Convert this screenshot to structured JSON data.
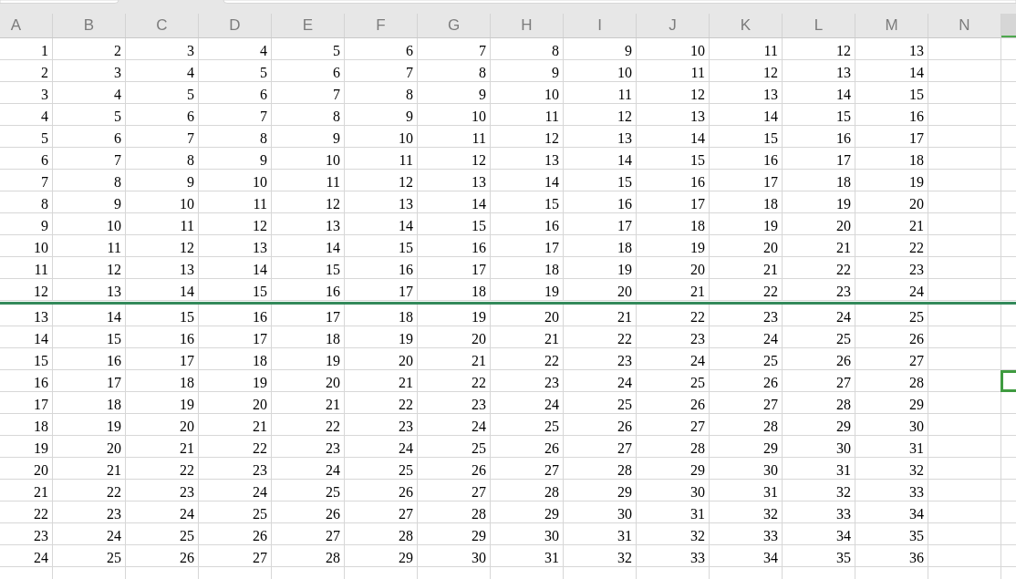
{
  "columns": [
    {
      "label": "A",
      "selected": false
    },
    {
      "label": "B",
      "selected": false
    },
    {
      "label": "C",
      "selected": false
    },
    {
      "label": "D",
      "selected": false
    },
    {
      "label": "E",
      "selected": false
    },
    {
      "label": "F",
      "selected": false
    },
    {
      "label": "G",
      "selected": false
    },
    {
      "label": "H",
      "selected": false
    },
    {
      "label": "I",
      "selected": false
    },
    {
      "label": "J",
      "selected": false
    },
    {
      "label": "K",
      "selected": false
    },
    {
      "label": "L",
      "selected": false
    },
    {
      "label": "M",
      "selected": false
    },
    {
      "label": "N",
      "selected": false
    },
    {
      "selected": true
    }
  ],
  "rows": [
    {
      "cells": [
        "1",
        "2",
        "3",
        "4",
        "5",
        "6",
        "7",
        "8",
        "9",
        "10",
        "11",
        "12",
        "13"
      ],
      "freeze_line_below": false,
      "selected": false
    },
    {
      "cells": [
        "2",
        "3",
        "4",
        "5",
        "6",
        "7",
        "8",
        "9",
        "10",
        "11",
        "12",
        "13",
        "14"
      ],
      "freeze_line_below": false,
      "selected": false
    },
    {
      "cells": [
        "3",
        "4",
        "5",
        "6",
        "7",
        "8",
        "9",
        "10",
        "11",
        "12",
        "13",
        "14",
        "15"
      ],
      "freeze_line_below": false,
      "selected": false
    },
    {
      "cells": [
        "4",
        "5",
        "6",
        "7",
        "8",
        "9",
        "10",
        "11",
        "12",
        "13",
        "14",
        "15",
        "16"
      ],
      "freeze_line_below": false,
      "selected": false
    },
    {
      "cells": [
        "5",
        "6",
        "7",
        "8",
        "9",
        "10",
        "11",
        "12",
        "13",
        "14",
        "15",
        "16",
        "17"
      ],
      "freeze_line_below": false,
      "selected": false
    },
    {
      "cells": [
        "6",
        "7",
        "8",
        "9",
        "10",
        "11",
        "12",
        "13",
        "14",
        "15",
        "16",
        "17",
        "18"
      ],
      "freeze_line_below": false,
      "selected": false
    },
    {
      "cells": [
        "7",
        "8",
        "9",
        "10",
        "11",
        "12",
        "13",
        "14",
        "15",
        "16",
        "17",
        "18",
        "19"
      ],
      "freeze_line_below": false,
      "selected": false
    },
    {
      "cells": [
        "8",
        "9",
        "10",
        "11",
        "12",
        "13",
        "14",
        "15",
        "16",
        "17",
        "18",
        "19",
        "20"
      ],
      "freeze_line_below": false,
      "selected": false
    },
    {
      "cells": [
        "9",
        "10",
        "11",
        "12",
        "13",
        "14",
        "15",
        "16",
        "17",
        "18",
        "19",
        "20",
        "21"
      ],
      "freeze_line_below": false,
      "selected": false
    },
    {
      "cells": [
        "10",
        "11",
        "12",
        "13",
        "14",
        "15",
        "16",
        "17",
        "18",
        "19",
        "20",
        "21",
        "22"
      ],
      "freeze_line_below": false,
      "selected": false
    },
    {
      "cells": [
        "11",
        "12",
        "13",
        "14",
        "15",
        "16",
        "17",
        "18",
        "19",
        "20",
        "21",
        "22",
        "23"
      ],
      "freeze_line_below": false,
      "selected": false
    },
    {
      "cells": [
        "12",
        "13",
        "14",
        "15",
        "16",
        "17",
        "18",
        "19",
        "20",
        "21",
        "22",
        "23",
        "24"
      ],
      "freeze_line_below": true,
      "selected": false
    },
    {
      "cells": [
        "13",
        "14",
        "15",
        "16",
        "17",
        "18",
        "19",
        "20",
        "21",
        "22",
        "23",
        "24",
        "25"
      ],
      "freeze_line_below": false,
      "selected": false
    },
    {
      "cells": [
        "14",
        "15",
        "16",
        "17",
        "18",
        "19",
        "20",
        "21",
        "22",
        "23",
        "24",
        "25",
        "26"
      ],
      "freeze_line_below": false,
      "selected": false
    },
    {
      "cells": [
        "15",
        "16",
        "17",
        "18",
        "19",
        "20",
        "21",
        "22",
        "23",
        "24",
        "25",
        "26",
        "27"
      ],
      "freeze_line_below": false,
      "selected": false
    },
    {
      "cells": [
        "16",
        "17",
        "18",
        "19",
        "20",
        "21",
        "22",
        "23",
        "24",
        "25",
        "26",
        "27",
        "28"
      ],
      "freeze_line_below": false,
      "selected": true
    },
    {
      "cells": [
        "17",
        "18",
        "19",
        "20",
        "21",
        "22",
        "23",
        "24",
        "25",
        "26",
        "27",
        "28",
        "29"
      ],
      "freeze_line_below": false,
      "selected": false
    },
    {
      "cells": [
        "18",
        "19",
        "20",
        "21",
        "22",
        "23",
        "24",
        "25",
        "26",
        "27",
        "28",
        "29",
        "30"
      ],
      "freeze_line_below": false,
      "selected": false
    },
    {
      "cells": [
        "19",
        "20",
        "21",
        "22",
        "23",
        "24",
        "25",
        "26",
        "27",
        "28",
        "29",
        "30",
        "31"
      ],
      "freeze_line_below": false,
      "selected": false
    },
    {
      "cells": [
        "20",
        "21",
        "22",
        "23",
        "24",
        "25",
        "26",
        "27",
        "28",
        "29",
        "30",
        "31",
        "32"
      ],
      "freeze_line_below": false,
      "selected": false
    },
    {
      "cells": [
        "21",
        "22",
        "23",
        "24",
        "25",
        "26",
        "27",
        "28",
        "29",
        "30",
        "31",
        "32",
        "33"
      ],
      "freeze_line_below": false,
      "selected": false
    },
    {
      "cells": [
        "22",
        "23",
        "24",
        "25",
        "26",
        "27",
        "28",
        "29",
        "30",
        "31",
        "32",
        "33",
        "34"
      ],
      "freeze_line_below": false,
      "selected": false
    },
    {
      "cells": [
        "23",
        "24",
        "25",
        "26",
        "27",
        "28",
        "29",
        "30",
        "31",
        "32",
        "33",
        "34",
        "35"
      ],
      "freeze_line_below": false,
      "selected": false
    },
    {
      "cells": [
        "24",
        "25",
        "26",
        "27",
        "28",
        "29",
        "30",
        "31",
        "32",
        "33",
        "34",
        "35",
        "36"
      ],
      "freeze_line_below": false,
      "selected": false
    }
  ]
}
